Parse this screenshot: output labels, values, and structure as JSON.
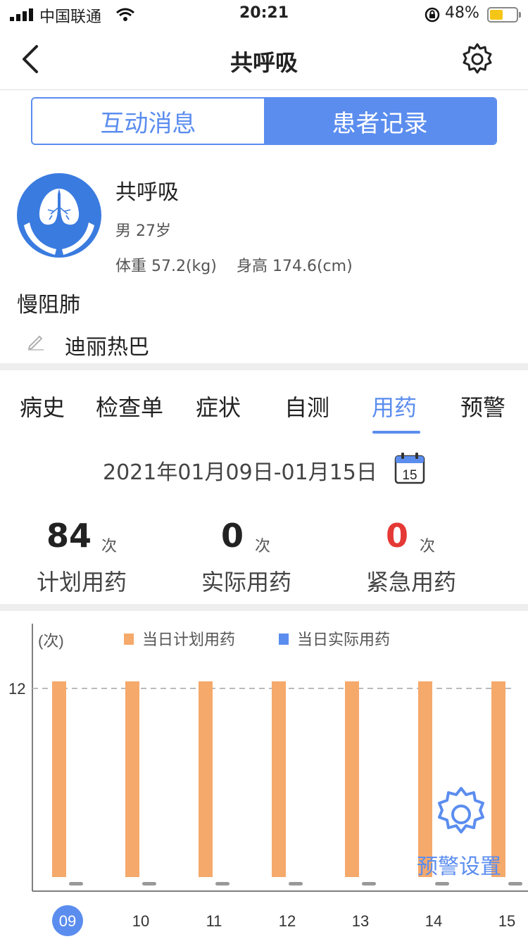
{
  "statusbar": {
    "carrier": "中国联通",
    "time": "20:21",
    "battery": "48%",
    "battery_level": 0.48
  },
  "nav": {
    "title": "共呼吸",
    "back_icon": "chevron-left-icon",
    "settings_icon": "gear-icon"
  },
  "segments": [
    {
      "label": "互动消息",
      "active": false
    },
    {
      "label": "患者记录",
      "active": true
    }
  ],
  "patient": {
    "name": "共呼吸",
    "sex_age": "男 27岁",
    "weight": "体重 57.2(kg)",
    "height": "身高 174.6(cm)",
    "diagnosis": "慢阻肺",
    "doctor": "迪丽热巴"
  },
  "tabs": [
    {
      "label": "病史",
      "active": false
    },
    {
      "label": "检查单",
      "active": false
    },
    {
      "label": "症状",
      "active": false
    },
    {
      "label": "自测",
      "active": false
    },
    {
      "label": "用药",
      "active": true
    },
    {
      "label": "预警",
      "active": false
    }
  ],
  "date_range": "2021年01月09日-01月15日",
  "calendar_day": "15",
  "stats": [
    {
      "value": "84",
      "unit": "次",
      "label": "计划用药",
      "color": "#222222"
    },
    {
      "value": "0",
      "unit": "次",
      "label": "实际用药",
      "color": "#222222"
    },
    {
      "value": "0",
      "unit": "次",
      "label": "紧急用药",
      "color": "#e53935"
    }
  ],
  "fab": {
    "label": "预警设置",
    "icon": "gear-icon"
  },
  "colors": {
    "accent": "#5b8def",
    "planned": "#f5a96b",
    "actual": "#5b8def",
    "emergency": "#e53935"
  },
  "chart_data": {
    "type": "bar",
    "ylabel": "(次)",
    "yticks": [
      12
    ],
    "ylim": [
      0,
      12
    ],
    "categories": [
      "09",
      "10",
      "11",
      "12",
      "13",
      "14",
      "15"
    ],
    "selected_category": "09",
    "series": [
      {
        "name": "当日计划用药",
        "values": [
          12,
          12,
          12,
          12,
          12,
          12,
          12
        ]
      },
      {
        "name": "当日实际用药",
        "values": [
          0,
          0,
          0,
          0,
          0,
          0,
          0
        ]
      }
    ],
    "legend_position": "top"
  }
}
